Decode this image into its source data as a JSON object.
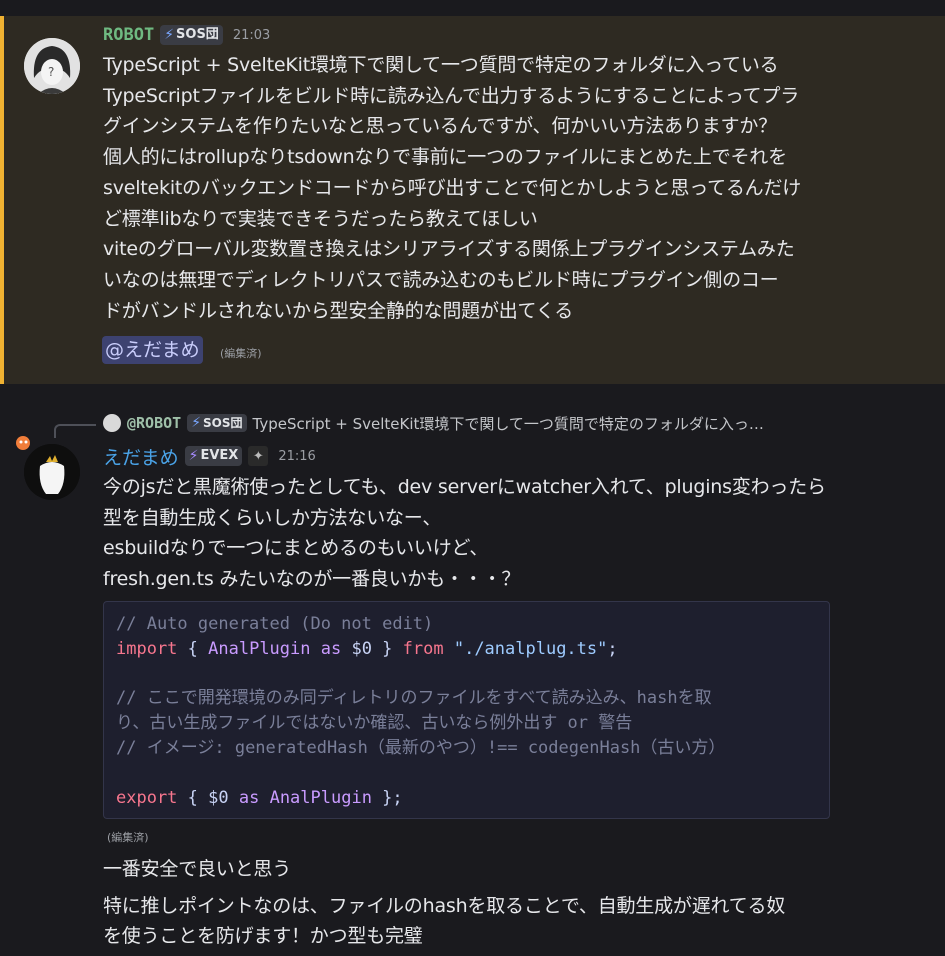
{
  "message1": {
    "author": "ROBOT",
    "tag": "SOS団",
    "time": "21:03",
    "lines": [
      "TypeScript + SvelteKit環境下で関して一つ質問で特定のフォルダに入っている",
      "TypeScriptファイルをビルド時に読み込んで出力するようにすることによってプラ",
      "グインシステムを作りたいなと思っているんですが、何かいい方法ありますか？",
      "個人的にはrollupなりtsdownなりで事前に一つのファイルにまとめた上でそれを",
      "sveltekitのバックエンドコードから呼び出すことで何とかしようと思ってるんだけ",
      "ど標準libなりで実装できそうだったら教えてほしい",
      "viteのグローバル変数置き換えはシリアライズする関係上プラグインシステムみた",
      "いなのは無理でディレクトリパスで読み込むのもビルド時にプラグイン側のコー",
      "ドがバンドルされないから型安全静的な問題が出てくる"
    ],
    "mention": "@えだまめ",
    "edited": "(編集済)"
  },
  "message2": {
    "reply": {
      "author": "@ROBOT",
      "tag": "SOS団",
      "preview": "TypeScript + SvelteKit環境下で関して一つ質問で特定のフォルダに入っ…"
    },
    "author": "えだまめ",
    "tag": "EVEX",
    "time": "21:16",
    "lines": [
      "今のjsだと黒魔術使ったとしても、dev serverにwatcher入れて、plugins変わったら",
      "型を自動生成くらいしか方法ないなー、",
      "esbuildなりで一つにまとめるのもいいけど、",
      "fresh.gen.ts みたいなのが一番良いかも・・・？"
    ],
    "code": {
      "line1": "// Auto generated (Do not edit)",
      "line2_kw1": "import",
      "line2_p1": " { ",
      "line2_id1": "AnalPlugin",
      "line2_kw2": " as ",
      "line2_p2": "$0 } ",
      "line2_kw3": "from",
      "line2_p3": " ",
      "line2_str": "\"./analplug.ts\"",
      "line2_end": ";",
      "line4": "// ここで開発環境のみ同ディレトリのファイルをすべて読み込み、hashを取",
      "line5": "り、古い生成ファイルではないか確認、古いなら例外出す or 警告",
      "line6": "// イメージ: generatedHash（最新のやつ）!== codegenHash（古い方）",
      "line8_kw1": "export",
      "line8_p1": " { $0 ",
      "line8_kw2": "as",
      "line8_p2": " ",
      "line8_id": "AnalPlugin",
      "line8_end": " };"
    },
    "edited": "(編集済)",
    "after1": "一番安全で良いと思う",
    "after2": "特に推しポイントなのは、ファイルのhashを取ることで、自動生成が遅れてる奴",
    "after3": "を使うことを防げます！かつ型も完璧"
  },
  "colors": {
    "highlight_bg": "#2e2a22",
    "highlight_bar": "#f0b232",
    "robot_name": "#6fb981",
    "edamame_name": "#4aa3e8"
  }
}
